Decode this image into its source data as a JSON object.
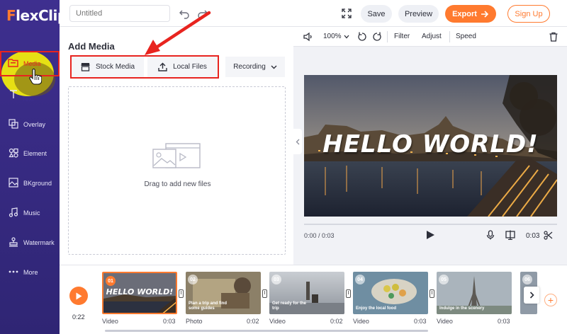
{
  "app": {
    "logo": "FlexClip"
  },
  "sidebar": {
    "items": [
      {
        "label": "Media",
        "icon": "media-folder-icon",
        "active": true
      },
      {
        "label": "Text",
        "icon": "text-icon"
      },
      {
        "label": "Overlay",
        "icon": "overlay-icon"
      },
      {
        "label": "Element",
        "icon": "element-icon"
      },
      {
        "label": "BKground",
        "icon": "background-icon"
      },
      {
        "label": "Music",
        "icon": "music-icon"
      },
      {
        "label": "Watermark",
        "icon": "watermark-icon"
      },
      {
        "label": "More",
        "icon": "more-icon"
      }
    ]
  },
  "topbar": {
    "title_placeholder": "Untitled",
    "save_label": "Save",
    "preview_label": "Preview",
    "export_label": "Export",
    "signup_label": "Sign Up"
  },
  "media_panel": {
    "title": "Add Media",
    "tabs": [
      {
        "label": "Stock Media"
      },
      {
        "label": "Local Files"
      },
      {
        "label": "Recording"
      }
    ],
    "drop_text": "Drag to add new files"
  },
  "editor": {
    "zoom": "100%",
    "filter_label": "Filter",
    "adjust_label": "Adjust",
    "speed_label": "Speed",
    "video_title": "HELLO WORLD!",
    "time_current": "0:00 / 0:03",
    "time_duration": "0:03"
  },
  "timeline": {
    "current_time": "0:22",
    "clips": [
      {
        "num": "01",
        "type": "Video",
        "duration": "0:03",
        "caption": "HELLO WORLD!"
      },
      {
        "num": "02",
        "type": "Photo",
        "duration": "0:02",
        "caption": "Plan a trip and find some guides"
      },
      {
        "num": "03",
        "type": "Video",
        "duration": "0:02",
        "caption": "Get ready for the trip"
      },
      {
        "num": "04",
        "type": "Video",
        "duration": "0:03",
        "caption": "Enjoy the local food"
      },
      {
        "num": "05",
        "type": "Video",
        "duration": "0:03",
        "caption": "Indulge in the scenery"
      },
      {
        "num": "06",
        "type": "",
        "duration": "",
        "caption": ""
      }
    ]
  },
  "colors": {
    "accent": "#ff7a2f",
    "sidebar": "#3e2f8f",
    "highlight": "#e8241f"
  }
}
